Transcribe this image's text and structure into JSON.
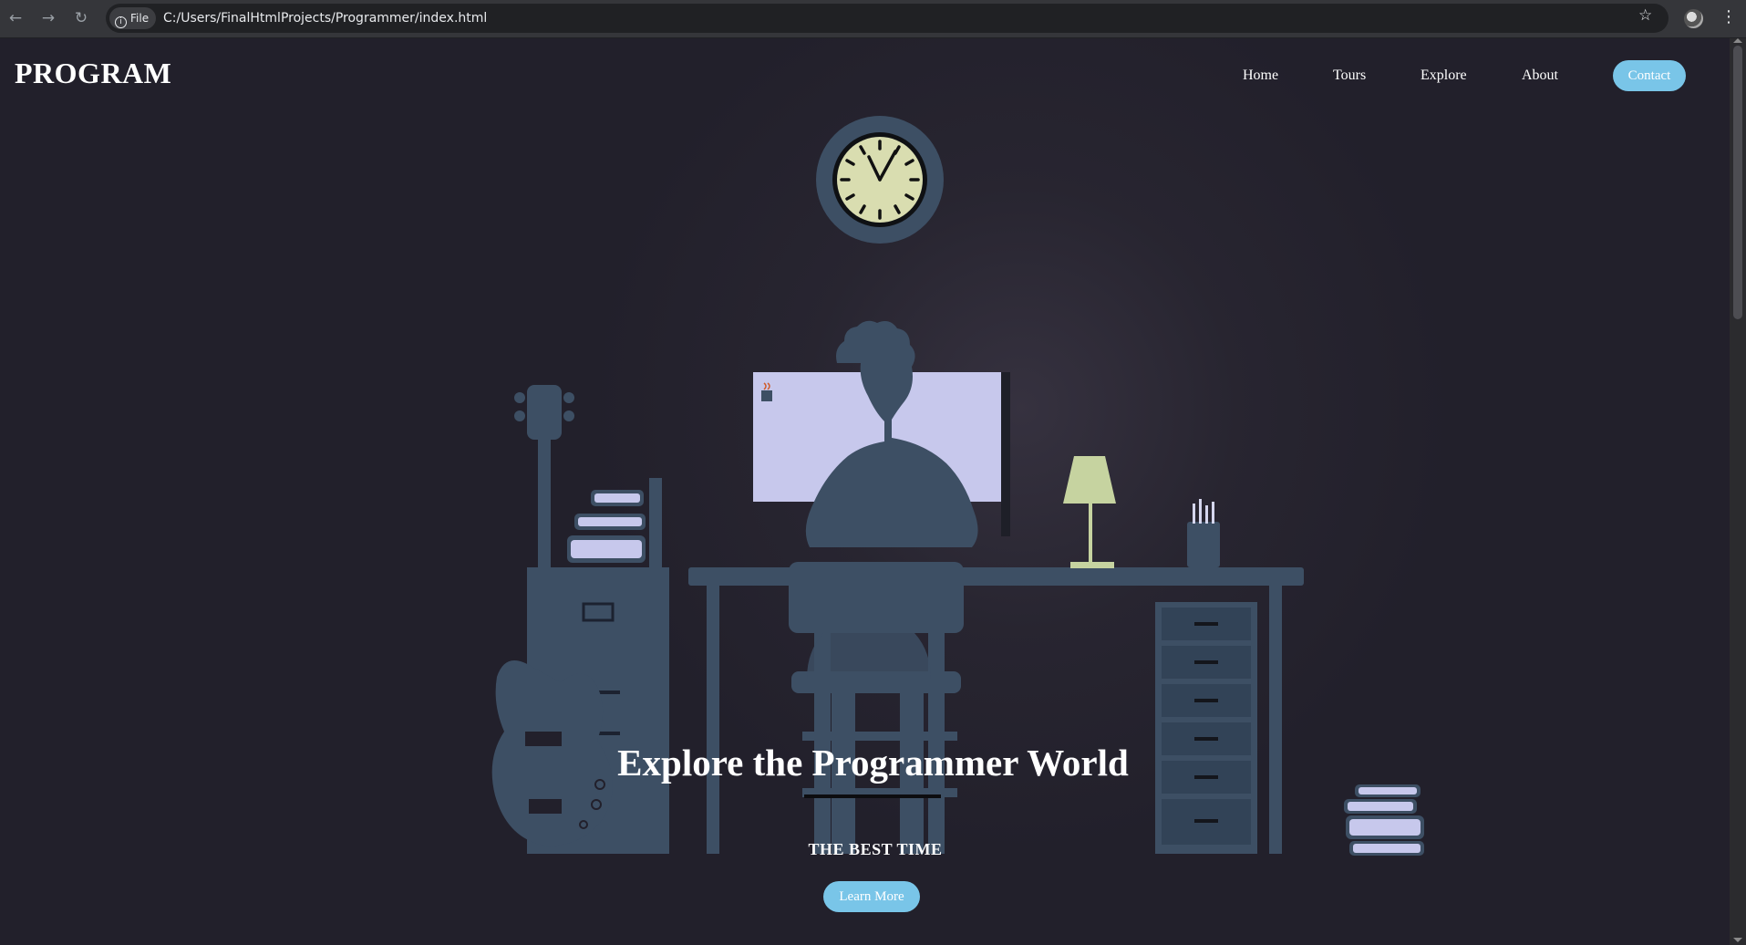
{
  "browser": {
    "file_chip": "File",
    "url": "C:/Users/FinalHtmlProjects/Programmer/index.html",
    "back_icon": "←",
    "forward_icon": "→",
    "reload_icon": "↻",
    "star_icon": "☆",
    "menu_icon": "⋮"
  },
  "header": {
    "logo": "PROGRAM",
    "nav": [
      "Home",
      "Tours",
      "Explore",
      "About"
    ],
    "contact": "Contact"
  },
  "hero": {
    "title": "Explore the Programmer World",
    "subtitle": "THE BEST TIME",
    "button": "Learn More"
  },
  "colors": {
    "background": "#22202b",
    "accent": "#79c5e8",
    "silhouette": "#3d4f64",
    "screen": "#c7c8ec",
    "lamp": "#c6d3a0"
  }
}
